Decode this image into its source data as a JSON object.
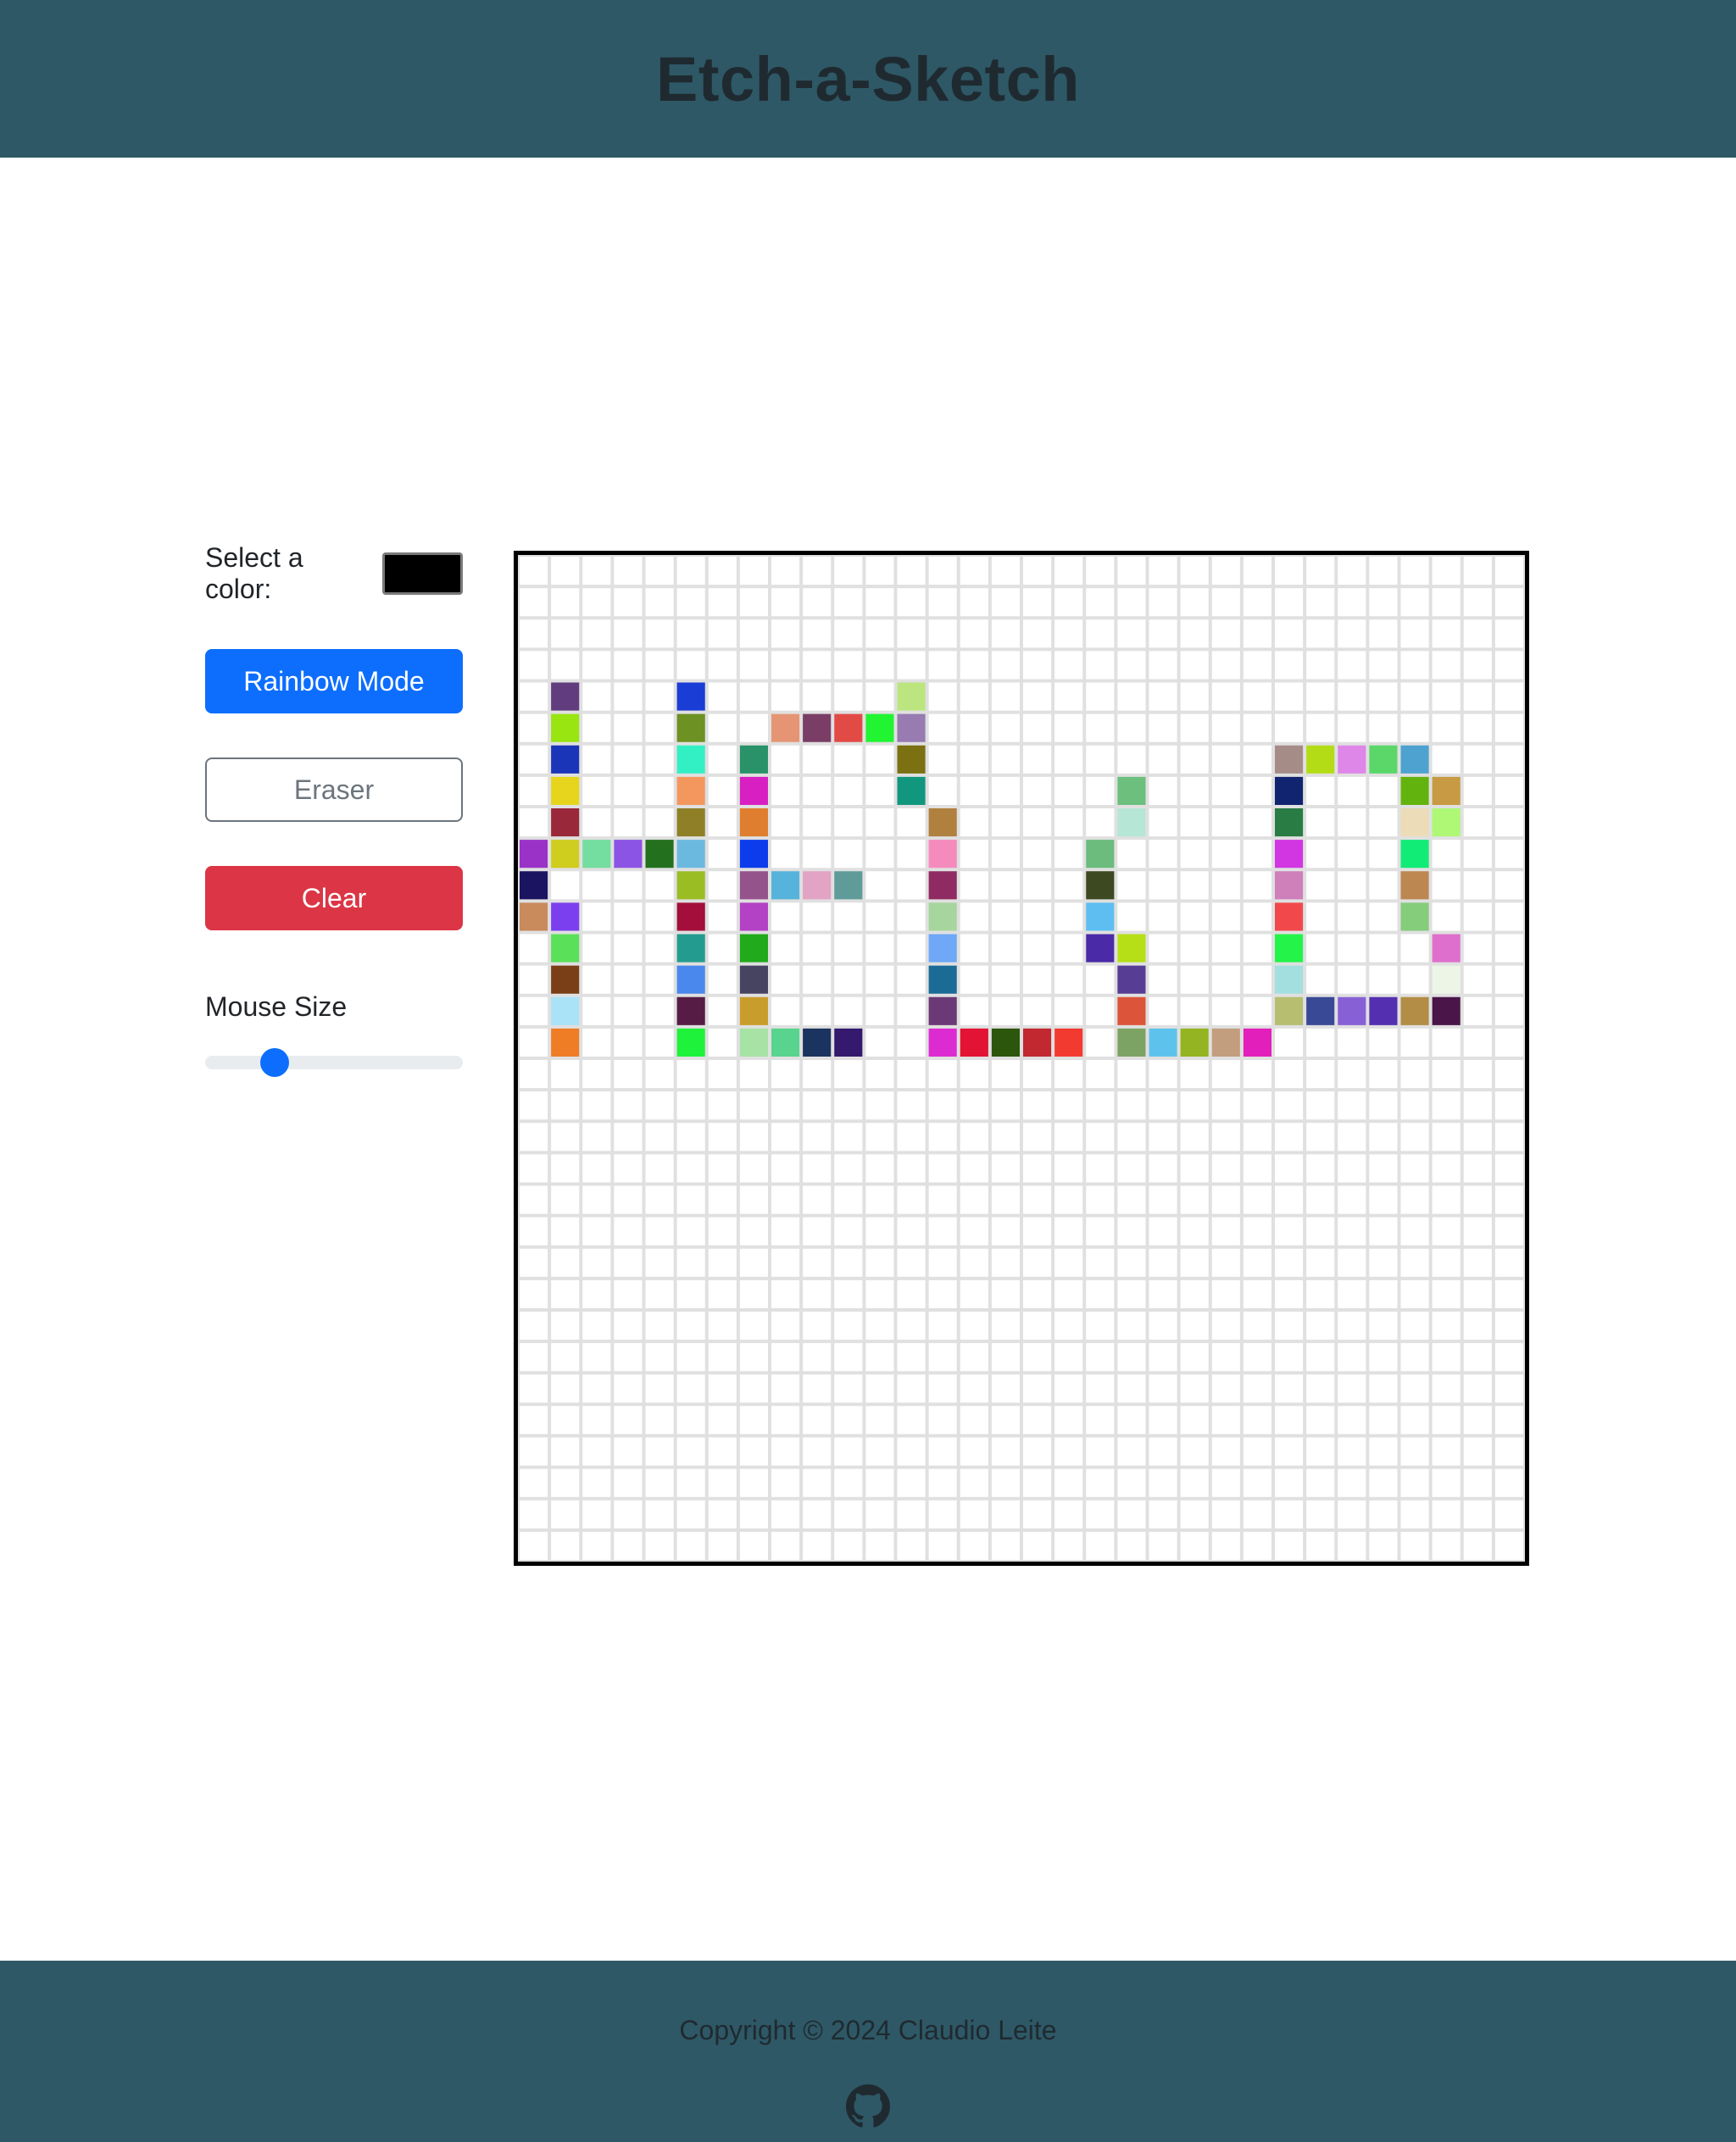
{
  "header": {
    "title": "Etch-a-Sketch"
  },
  "controls": {
    "color_label": "Select a color:",
    "selected_color": "#000000",
    "rainbow_label": "Rainbow Mode",
    "eraser_label": "Eraser",
    "clear_label": "Clear",
    "mouse_size_label": "Mouse Size",
    "mouse_size_fraction": 0.27
  },
  "board": {
    "grid_size": 32,
    "grid_color": "#e0e0e0",
    "painted_cells": [
      [
        1,
        4,
        "#613d80"
      ],
      [
        1,
        5,
        "#98e512"
      ],
      [
        1,
        6,
        "#1a35b8"
      ],
      [
        1,
        7,
        "#e6d51c"
      ],
      [
        1,
        8,
        "#99283a"
      ],
      [
        1,
        9,
        "#cfcd1e"
      ],
      [
        1,
        11,
        "#7b3ff0"
      ],
      [
        1,
        12,
        "#5be05a"
      ],
      [
        1,
        13,
        "#7b3f17"
      ],
      [
        1,
        14,
        "#aae3f7"
      ],
      [
        1,
        15,
        "#ef7d26"
      ],
      [
        0,
        9,
        "#9a32c8"
      ],
      [
        0,
        10,
        "#1b1460"
      ],
      [
        0,
        11,
        "#c98a5c"
      ],
      [
        2,
        9,
        "#74dda0"
      ],
      [
        3,
        9,
        "#8b54e4"
      ],
      [
        4,
        9,
        "#23701f"
      ],
      [
        5,
        4,
        "#1a3dd6"
      ],
      [
        5,
        5,
        "#6d9122"
      ],
      [
        5,
        6,
        "#33f0c4"
      ],
      [
        5,
        7,
        "#f4975f"
      ],
      [
        5,
        8,
        "#8f7f27"
      ],
      [
        5,
        9,
        "#6cb9e0"
      ],
      [
        5,
        10,
        "#9bbd24"
      ],
      [
        5,
        11,
        "#a40e3a"
      ],
      [
        5,
        12,
        "#239c8f"
      ],
      [
        5,
        13,
        "#4a88ee"
      ],
      [
        5,
        14,
        "#571c45"
      ],
      [
        5,
        15,
        "#1ff23a"
      ],
      [
        8,
        5,
        "#e59573"
      ],
      [
        9,
        5,
        "#7a3d66"
      ],
      [
        10,
        5,
        "#e24a45"
      ],
      [
        11,
        5,
        "#21f532"
      ],
      [
        12,
        5,
        "#977bb1"
      ],
      [
        12,
        4,
        "#bde57f"
      ],
      [
        12,
        6,
        "#7b7012"
      ],
      [
        12,
        7,
        "#12977f"
      ],
      [
        7,
        6,
        "#2a9268"
      ],
      [
        7,
        7,
        "#d820c2"
      ],
      [
        7,
        8,
        "#e07e2f"
      ],
      [
        7,
        9,
        "#0c3cec"
      ],
      [
        7,
        10,
        "#94538a"
      ],
      [
        7,
        11,
        "#b342c4"
      ],
      [
        7,
        12,
        "#21aa1c"
      ],
      [
        7,
        13,
        "#474462"
      ],
      [
        7,
        14,
        "#c99d2c"
      ],
      [
        7,
        15,
        "#a7e3a4"
      ],
      [
        8,
        10,
        "#56b3db"
      ],
      [
        9,
        10,
        "#e2a3c4"
      ],
      [
        10,
        10,
        "#5f9c99"
      ],
      [
        8,
        15,
        "#58d48e"
      ],
      [
        9,
        15,
        "#1b335f"
      ],
      [
        10,
        15,
        "#34196f"
      ],
      [
        13,
        8,
        "#b0813e"
      ],
      [
        13,
        9,
        "#f58bbd"
      ],
      [
        13,
        10,
        "#8f2b62"
      ],
      [
        13,
        11,
        "#a6d59d"
      ],
      [
        13,
        12,
        "#6ea8f6"
      ],
      [
        13,
        13,
        "#1b6b97"
      ],
      [
        13,
        14,
        "#6b3976"
      ],
      [
        13,
        15,
        "#dd2bd2"
      ],
      [
        14,
        15,
        "#e21333"
      ],
      [
        15,
        15,
        "#2d560d"
      ],
      [
        16,
        15,
        "#c1282f"
      ],
      [
        17,
        15,
        "#f33a30"
      ],
      [
        19,
        7,
        "#6cbf7d"
      ],
      [
        19,
        8,
        "#b5e6d6"
      ],
      [
        18,
        9,
        "#6bbc7d"
      ],
      [
        18,
        10,
        "#3d4920"
      ],
      [
        18,
        11,
        "#5ebef2"
      ],
      [
        18,
        12,
        "#4a2aa7"
      ],
      [
        19,
        12,
        "#b6df17"
      ],
      [
        19,
        13,
        "#573e94"
      ],
      [
        19,
        14,
        "#dc553a"
      ],
      [
        19,
        15,
        "#7da364"
      ],
      [
        20,
        15,
        "#5ec3ec"
      ],
      [
        21,
        15,
        "#94b421"
      ],
      [
        22,
        15,
        "#c29e7f"
      ],
      [
        23,
        15,
        "#e21fba"
      ],
      [
        24,
        6,
        "#a68c87"
      ],
      [
        25,
        6,
        "#b3dc17"
      ],
      [
        26,
        6,
        "#de87e8"
      ],
      [
        27,
        6,
        "#5bd76a"
      ],
      [
        28,
        6,
        "#4ea2cf"
      ],
      [
        24,
        7,
        "#11246f"
      ],
      [
        24,
        8,
        "#287c44"
      ],
      [
        24,
        9,
        "#d136e2"
      ],
      [
        24,
        10,
        "#cf7fba"
      ],
      [
        24,
        11,
        "#f1494b"
      ],
      [
        24,
        12,
        "#24f44a"
      ],
      [
        24,
        13,
        "#a4dfdf"
      ],
      [
        24,
        14,
        "#b7be70"
      ],
      [
        25,
        14,
        "#394996"
      ],
      [
        26,
        14,
        "#8760d6"
      ],
      [
        27,
        14,
        "#5430b0"
      ],
      [
        28,
        14,
        "#b38c46"
      ],
      [
        29,
        14,
        "#4a1548"
      ],
      [
        28,
        7,
        "#63b30f"
      ],
      [
        29,
        7,
        "#c79a43"
      ],
      [
        28,
        8,
        "#ecdcb7"
      ],
      [
        29,
        8,
        "#aef876"
      ],
      [
        28,
        9,
        "#11ec76"
      ],
      [
        28,
        10,
        "#bd8751"
      ],
      [
        28,
        11,
        "#85cc7b"
      ],
      [
        29,
        12,
        "#df6fcc"
      ],
      [
        29,
        13,
        "#edf6e6"
      ]
    ]
  },
  "footer": {
    "copyright": "Copyright © 2024 Claudio Leite",
    "icon": "github-icon"
  }
}
